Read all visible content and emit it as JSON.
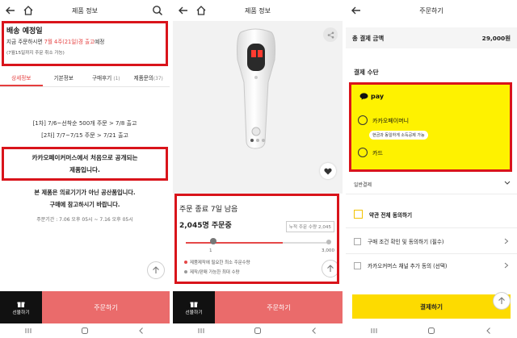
{
  "panel1": {
    "title": "제품 정보",
    "shipping": {
      "heading": "배송 예정일",
      "line_prefix": "지금 주문하시면 ",
      "line_highlight": "7월 4주(21일)경 출고",
      "line_suffix": "예정",
      "note": "(7월15일까지 주문 취소 가능)"
    },
    "tabs": [
      {
        "label": "상세정보",
        "count": ""
      },
      {
        "label": "기본정보",
        "count": ""
      },
      {
        "label": "구매후기",
        "count": "(1)"
      },
      {
        "label": "제품문의",
        "count": "(37)"
      }
    ],
    "schedule": [
      "[1차] 7/6~선착순 500개 주문 > 7/8 출고",
      "[2차] 7/7~7/15 주문 > 7/21 출고"
    ],
    "kakao_lines": [
      "카카오페이커머스에서 처음으로 공개되는",
      "제품입니다."
    ],
    "notice_lines": [
      "본 제품은 의료기기가 아닌 공산품입니다.",
      "구매에 참고하시기 바랍니다."
    ],
    "period": "주문기간 : 7.06 오후 05시 ~ 7.16 오후 05시",
    "gift_label": "선물하기",
    "order_label": "주문하기"
  },
  "panel2": {
    "title": "제품 정보",
    "remaining": "주문 종료 7일 남음",
    "order_count": "2,045명 주문중",
    "cumulative": "누적 주문 수량 2,045",
    "slider": {
      "min_label": "1",
      "max_label": "3,000",
      "progress": 0.68
    },
    "legend": [
      {
        "text": "제품제작에 필요한 최소 주문수량",
        "color": "#e54848"
      },
      {
        "text": "제작/판매 가능한 최대 수량",
        "color": "#999999"
      }
    ],
    "gift_label": "선물하기",
    "order_label": "주문하기"
  },
  "panel3": {
    "title": "주문하기",
    "total_label": "총 결제 금액",
    "total_value": "29,000원",
    "pay_method": "결제 수단",
    "kpay_logo": "pay",
    "kpay_money": "카카오페이머니",
    "kpay_tag": "현금과 동일하게 소득공제 가능",
    "kpay_card": "카드",
    "general": "일반결제",
    "agree_all": "약관 전체 동의하기",
    "agree_items": [
      "구매 조건 확인 및 동의하기 (필수)",
      "카카오커머스 채널 추가 동의 (선택)"
    ],
    "pay_button": "결제하기"
  },
  "colors": {
    "highlight_red": "#d9141b",
    "order_button": "#ea6b6b",
    "kakao_yellow": "#fef200",
    "pay_button": "#fddb00"
  },
  "icons": [
    "back-icon",
    "home-icon",
    "search-icon",
    "share-icon",
    "heart-icon",
    "gift-icon",
    "arrow-up-icon",
    "chevron-down-icon",
    "chevron-right-icon",
    "chat-bubble-icon"
  ]
}
